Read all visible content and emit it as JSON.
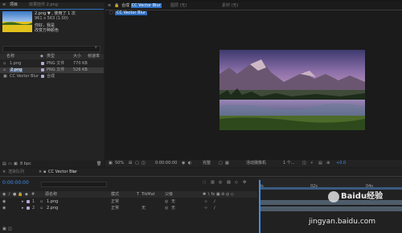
{
  "project_panel": {
    "tab_label": "项目",
    "effects_tab": "效果控件 2.png",
    "selected_name": "2.png ▼ , 使用了 1 次",
    "selected_dims": "961 x 563 (1.00)",
    "selected_caption_1": "你好，我是",
    "selected_caption_2": "改变万种颜色",
    "columns": {
      "name": "名称",
      "label": "",
      "type": "类型",
      "size": "大小",
      "rate": "帧速率"
    },
    "items": [
      {
        "name": "1.png",
        "type": "PNG 文件",
        "size": "770 KB",
        "selected": false,
        "color": "#b7a6d8"
      },
      {
        "name": "2.png",
        "type": "PNG 文件",
        "size": "526 KB",
        "selected": true,
        "color": "#b7a6d8"
      },
      {
        "name": "CC Vector Blur",
        "type": "合成",
        "size": "",
        "selected": false,
        "color": "#b7a6d8"
      }
    ],
    "footer_bpc": "8 bpc"
  },
  "composition_panel": {
    "tab_prefix": "合成",
    "tab_name": "CC Vector Blur",
    "layer_tab": "图层 (无)",
    "footage_tab": "素材 (无)",
    "sub_tab": "CC Vector Blur",
    "zoom": "50%",
    "timecode": "0:00:00:00",
    "quality": "完整",
    "camera": "活动摄像机",
    "views": "1 个...",
    "exposure": "+0.0"
  },
  "timeline": {
    "tab_render": "渲染队列",
    "tab_comp": "CC Vector Blur",
    "timecode": "0:00:00:00",
    "search_placeholder": "",
    "col_num": "#",
    "col_name": "源名称",
    "col_mode": "模式",
    "col_t": "T",
    "col_trkmat": "TrkMat",
    "col_parent": "父级",
    "ruler": [
      "0s",
      "02s",
      "04s"
    ],
    "layers": [
      {
        "num": "1",
        "name": "1.png",
        "mode": "正常",
        "trkmat": "",
        "parent": "无"
      },
      {
        "num": "2",
        "name": "2.png",
        "mode": "正常",
        "trkmat": "无",
        "parent": "无"
      }
    ]
  },
  "watermark": {
    "line1": "Baidu经验",
    "line2": "jingyan.baidu.com"
  }
}
